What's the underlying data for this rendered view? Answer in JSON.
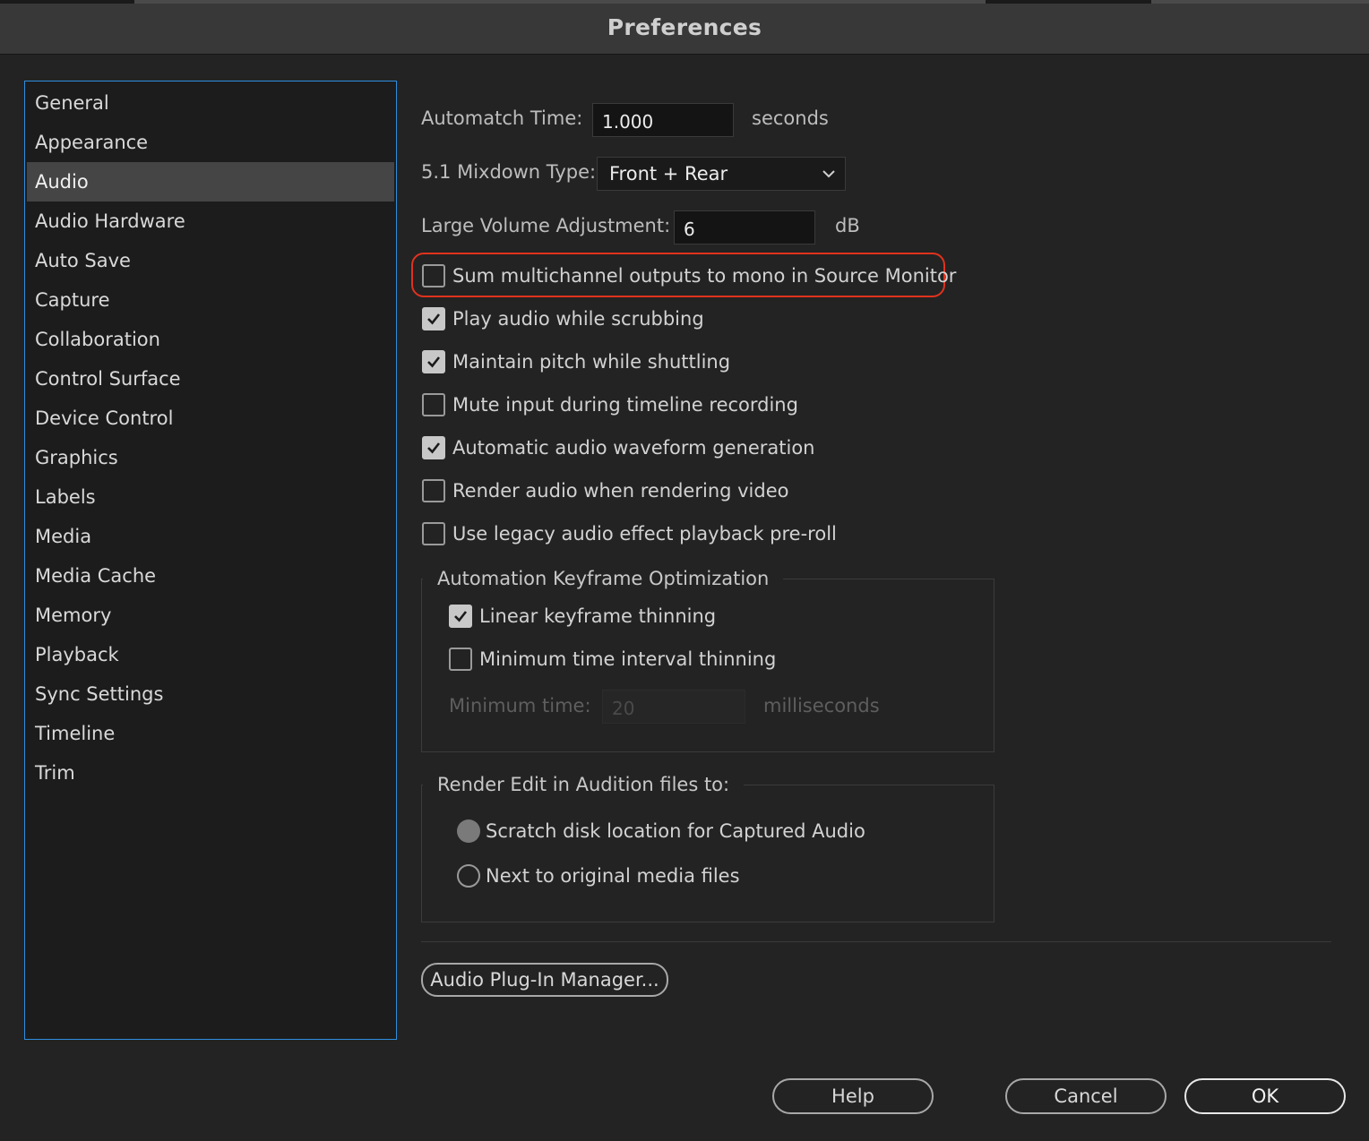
{
  "window": {
    "title": "Preferences"
  },
  "sidebar": {
    "items": [
      {
        "label": "General"
      },
      {
        "label": "Appearance"
      },
      {
        "label": "Audio",
        "selected": true
      },
      {
        "label": "Audio Hardware"
      },
      {
        "label": "Auto Save"
      },
      {
        "label": "Capture"
      },
      {
        "label": "Collaboration"
      },
      {
        "label": "Control Surface"
      },
      {
        "label": "Device Control"
      },
      {
        "label": "Graphics"
      },
      {
        "label": "Labels"
      },
      {
        "label": "Media"
      },
      {
        "label": "Media Cache"
      },
      {
        "label": "Memory"
      },
      {
        "label": "Playback"
      },
      {
        "label": "Sync Settings"
      },
      {
        "label": "Timeline"
      },
      {
        "label": "Trim"
      }
    ]
  },
  "audio": {
    "automatch_label": "Automatch Time:",
    "automatch_value": "1.000",
    "automatch_unit": "seconds",
    "mixdown_label": "5.1 Mixdown Type:",
    "mixdown_value": "Front + Rear",
    "volume_label": "Large Volume Adjustment:",
    "volume_value": "6",
    "volume_unit": "dB",
    "options": [
      {
        "label": "Sum multichannel outputs to mono in Source Monitor",
        "checked": false
      },
      {
        "label": "Play audio while scrubbing",
        "checked": true
      },
      {
        "label": "Maintain pitch while shuttling",
        "checked": true
      },
      {
        "label": "Mute input during timeline recording",
        "checked": false
      },
      {
        "label": "Automatic audio waveform generation",
        "checked": true
      },
      {
        "label": "Render audio when rendering video",
        "checked": false
      },
      {
        "label": "Use legacy audio effect playback pre-roll",
        "checked": false
      }
    ],
    "keyframe_group": {
      "title": "Automation Keyframe Optimization",
      "linear_label": "Linear keyframe thinning",
      "linear_checked": true,
      "min_interval_label": "Minimum time interval thinning",
      "min_interval_checked": false,
      "min_time_label": "Minimum time:",
      "min_time_value": "20",
      "min_time_unit": "milliseconds"
    },
    "render_group": {
      "title": "Render Edit in Audition files to:",
      "option_scratch": "Scratch disk location for Captured Audio",
      "option_next": "Next to original media files"
    },
    "plugin_button": "Audio Plug-In Manager..."
  },
  "footer": {
    "help": "Help",
    "cancel": "Cancel",
    "ok": "OK"
  }
}
